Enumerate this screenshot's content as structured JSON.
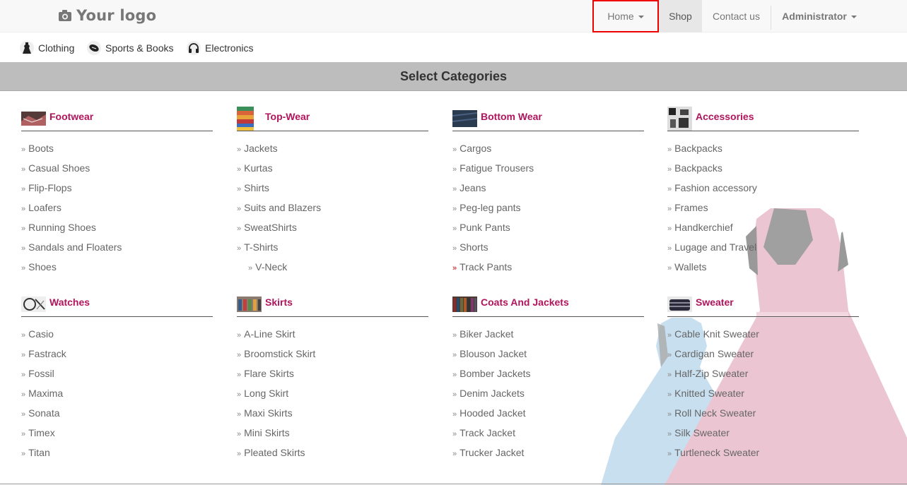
{
  "logo": {
    "text": "Your logo",
    "icon": "camera-icon"
  },
  "nav": {
    "home": "Home",
    "shop": "Shop",
    "contact": "Contact us",
    "admin": "Administrator"
  },
  "submenu": {
    "items": [
      {
        "label": "Clothing",
        "icon": "dress-icon"
      },
      {
        "label": "Sports & Books",
        "icon": "football-icon"
      },
      {
        "label": "Electronics",
        "icon": "headphones-icon"
      }
    ]
  },
  "band": {
    "title": "Select Categories"
  },
  "categories": [
    {
      "title": "Footwear",
      "items": [
        "Boots",
        "Casual Shoes",
        "Flip-Flops",
        "Loafers",
        "Running Shoes",
        "Sandals and Floaters",
        "Shoes"
      ]
    },
    {
      "title": "Top-Wear",
      "items": [
        "Jackets",
        "Kurtas",
        "Shirts",
        "Suits and Blazers",
        "SweatShirts",
        "T-Shirts",
        "V-Neck"
      ]
    },
    {
      "title": "Bottom Wear",
      "items": [
        "Cargos",
        "Fatigue Trousers",
        "Jeans",
        "Peg-leg pants",
        "Punk Pants",
        "Shorts",
        "Track Pants"
      ]
    },
    {
      "title": "Accessories",
      "items": [
        "Backpacks",
        "Backpacks",
        "Fashion accessory",
        "Frames",
        "Handkerchief",
        "Lugage and Travel",
        "Wallets"
      ]
    },
    {
      "title": "Watches",
      "items": [
        "Casio",
        "Fastrack",
        "Fossil",
        "Maxima",
        "Sonata",
        "Timex",
        "Titan"
      ]
    },
    {
      "title": "Skirts",
      "items": [
        "A-Line Skirt",
        "Broomstick Skirt",
        "Flare Skirts",
        "Long Skirt",
        "Maxi Skirts",
        "Mini Skirts",
        "Pleated Skirts"
      ]
    },
    {
      "title": "Coats And Jackets",
      "items": [
        "Biker Jacket",
        "Blouson Jacket",
        "Bomber Jackets",
        "Denim Jackets",
        "Hooded Jacket",
        "Track Jacket",
        "Trucker Jacket"
      ]
    },
    {
      "title": "Sweater",
      "items": [
        "Cable Knit Sweater",
        "Cardigan Sweater",
        "Half-Zip Sweater",
        "Knitted Sweater",
        "Roll Neck Sweater",
        "Silk Sweater",
        "Turtleneck Sweater"
      ]
    }
  ],
  "colors": {
    "accent": "#b0145c",
    "highlight_box": "#e00000",
    "band": "#bdbdbd"
  }
}
